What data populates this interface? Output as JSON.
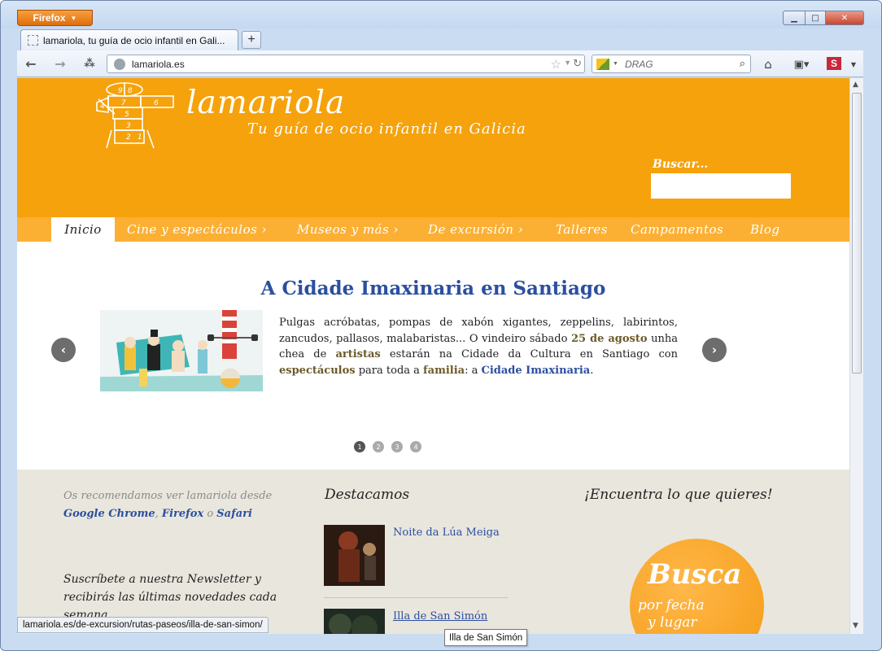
{
  "browser": {
    "menu_button": "Firefox",
    "tab_title": "lamariola, tu guía de ocio infantil en Gali...",
    "new_tab": "+",
    "url": "lamariola.es",
    "search_placeholder": "DRAG",
    "status_url": "lamariola.es/de-excursion/rutas-paseos/illa-de-san-simon/",
    "tooltip": "Illa de San Simón"
  },
  "header": {
    "logo_title": "lamariola",
    "logo_subtitle": "Tu guía de ocio infantil en Galicia",
    "search_label": "Buscar...",
    "hopscotch_numbers": [
      "9",
      "8",
      "7",
      "6",
      "5",
      "4",
      "3",
      "2",
      "1"
    ]
  },
  "menu": {
    "items": [
      {
        "label": "Inicio"
      },
      {
        "label": "Cine y espectáculos ›"
      },
      {
        "label": "Museos y más ›"
      },
      {
        "label": "De excursión ›"
      },
      {
        "label": "Talleres"
      },
      {
        "label": "Campamentos"
      },
      {
        "label": "Blog"
      }
    ]
  },
  "slider": {
    "title": "A Cidade Imaxinaria en Santiago",
    "text_1": "Pulgas acróbatas, pompas de xabón xigantes, zeppelins, labirintos, zancudos, pallasos, malabaristas...  O vindeiro sábado ",
    "date": "25 de agosto",
    "text_2": " unha chea de ",
    "artistas": "artistas",
    "text_3": " estarán na Cidade da Cultura en Santiago con ",
    "espectaculos": "espectáculos",
    "text_4": " para toda a ",
    "familia": "familia",
    "text_5": ": a ",
    "link": "Cidade Imaxinaria",
    "text_6": ".",
    "prev": "‹",
    "next": "›",
    "dots": [
      "1",
      "2",
      "3",
      "4"
    ],
    "active_dot": 1
  },
  "footer": {
    "recommend_text": "Os recomendamos ver lamariola desde",
    "browser_1": "Google Chrome",
    "sep_1": ", ",
    "browser_2": "Firefox",
    "sep_2": " o ",
    "browser_3": "Safari",
    "newsletter": "Suscríbete a nuestra Newsletter y recibirás las últimas novedades cada semana",
    "destacamos_title": "Destacamos",
    "destacados": [
      {
        "label": "Noite da Lúa Meiga"
      },
      {
        "label": "Illa de San Simón"
      }
    ],
    "find_title": "¡Encuentra lo que quieres!",
    "badge_1": "Busca",
    "badge_2": "por fecha",
    "badge_3": "y lugar"
  },
  "colors": {
    "header_orange": "#f5a20c",
    "menu_orange": "#fbb034",
    "link_blue": "#2b4fa0",
    "footer_bg": "#e9e6dd"
  }
}
